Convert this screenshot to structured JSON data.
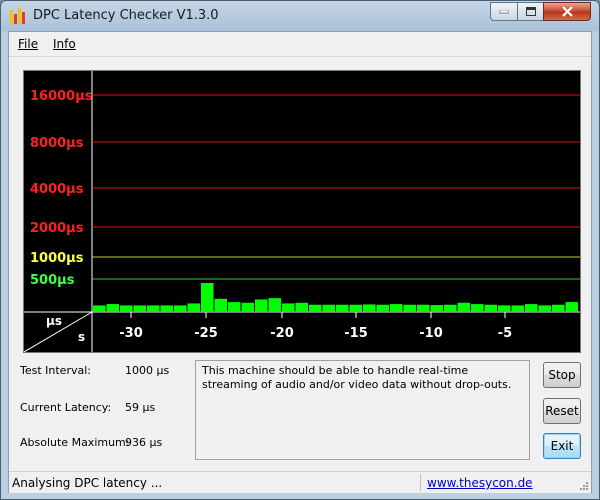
{
  "window": {
    "title": "DPC Latency Checker V1.3.0"
  },
  "menu": {
    "file": "File",
    "info": "Info"
  },
  "chart_data": {
    "type": "bar",
    "y_labels": [
      {
        "text": "16000µs",
        "value": 16000,
        "color": "#ff2020"
      },
      {
        "text": "8000µs",
        "value": 8000,
        "color": "#ff2020"
      },
      {
        "text": "4000µs",
        "value": 4000,
        "color": "#ff2020"
      },
      {
        "text": "2000µs",
        "value": 2000,
        "color": "#ff2020"
      },
      {
        "text": "1000µs",
        "value": 1000,
        "color": "#ffff40"
      },
      {
        "text": "500µs",
        "value": 500,
        "color": "#40ff40"
      }
    ],
    "y_unit": "µs",
    "x_unit": "s",
    "x_ticks": [
      "-30",
      "-25",
      "-20",
      "-15",
      "-10",
      "-5"
    ],
    "bar_color": "#00ff00",
    "values": [
      100,
      120,
      100,
      100,
      100,
      100,
      100,
      130,
      440,
      200,
      150,
      140,
      190,
      210,
      130,
      140,
      110,
      110,
      110,
      110,
      115,
      110,
      120,
      110,
      110,
      105,
      110,
      140,
      120,
      110,
      100,
      100,
      120,
      100,
      110,
      150
    ]
  },
  "info": {
    "test_interval_label": "Test Interval:",
    "test_interval_value": "1000 µs",
    "current_latency_label": "Current Latency:",
    "current_latency_value": "59 µs",
    "absolute_max_label": "Absolute Maximum:",
    "absolute_max_value": "936 µs"
  },
  "message": "This machine should be able to handle real-time streaming of audio and/or video data without drop-outs.",
  "buttons": {
    "stop": "Stop",
    "reset": "Reset",
    "exit": "Exit"
  },
  "status": {
    "text": "Analysing DPC latency ...",
    "link": "www.thesycon.de"
  }
}
